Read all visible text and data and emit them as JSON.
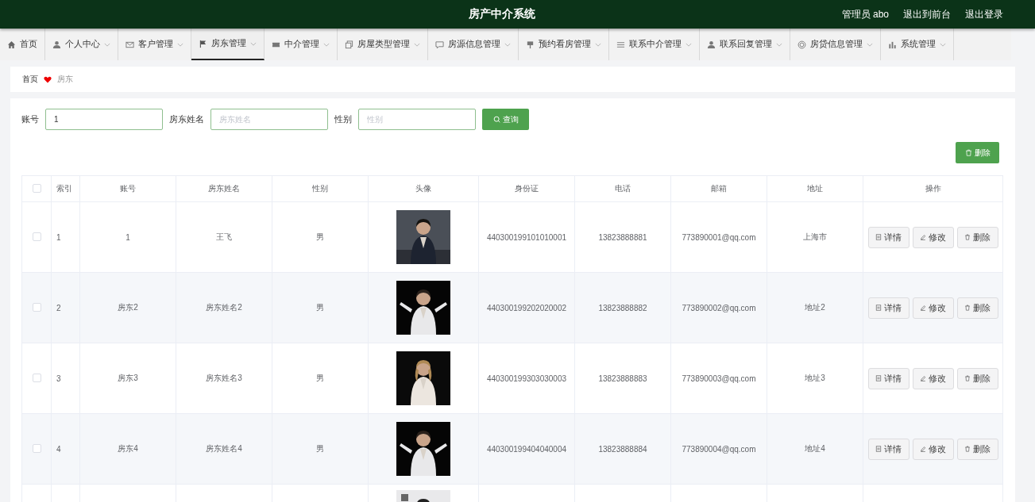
{
  "header": {
    "title": "房产中介系统",
    "links": [
      "管理员 abo",
      "退出到前台",
      "退出登录"
    ]
  },
  "nav": [
    {
      "label": "首页",
      "dropdown": false,
      "selected": false
    },
    {
      "label": "个人中心",
      "dropdown": true,
      "selected": false
    },
    {
      "label": "客户管理",
      "dropdown": true,
      "selected": false
    },
    {
      "label": "房东管理",
      "dropdown": true,
      "selected": true
    },
    {
      "label": "中介管理",
      "dropdown": true,
      "selected": false
    },
    {
      "label": "房屋类型管理",
      "dropdown": true,
      "selected": false
    },
    {
      "label": "房源信息管理",
      "dropdown": true,
      "selected": false
    },
    {
      "label": "预约看房管理",
      "dropdown": true,
      "selected": false
    },
    {
      "label": "联系中介管理",
      "dropdown": true,
      "selected": false
    },
    {
      "label": "联系回复管理",
      "dropdown": true,
      "selected": false
    },
    {
      "label": "房贷信息管理",
      "dropdown": true,
      "selected": false
    },
    {
      "label": "系统管理",
      "dropdown": true,
      "selected": false
    }
  ],
  "breadcrumb": [
    "首页",
    "房东"
  ],
  "search": {
    "fields": [
      {
        "label": "账号",
        "value": "1"
      },
      {
        "label": "房东姓名",
        "placeholder": "房东姓名"
      },
      {
        "label": "性别",
        "placeholder": "性别"
      }
    ],
    "button": "查询"
  },
  "delete_button": "删除",
  "table": {
    "columns": [
      "索引",
      "账号",
      "房东姓名",
      "性别",
      "头像",
      "身份证",
      "电话",
      "邮箱",
      "地址",
      "操作"
    ],
    "header_checked": false,
    "rows": [
      {
        "checked": false,
        "index": "1",
        "account": "1",
        "name": "王飞",
        "gender": "男",
        "id_card": "440300199101010001",
        "phone": "13823888881",
        "email": "773890001@qq.com",
        "address": "上海市",
        "actions": [
          "详情",
          "修改",
          "删除"
        ]
      },
      {
        "checked": false,
        "index": "2",
        "account": "房东2",
        "name": "房东姓名2",
        "gender": "男",
        "id_card": "440300199202020002",
        "phone": "13823888882",
        "email": "773890002@qq.com",
        "address": "地址2",
        "actions": [
          "详情",
          "修改",
          "删除"
        ]
      },
      {
        "checked": false,
        "index": "3",
        "account": "房东3",
        "name": "房东姓名3",
        "gender": "男",
        "id_card": "440300199303030003",
        "phone": "13823888883",
        "email": "773890003@qq.com",
        "address": "地址3",
        "actions": [
          "详情",
          "修改",
          "删除"
        ]
      },
      {
        "checked": false,
        "index": "4",
        "account": "房东4",
        "name": "房东姓名4",
        "gender": "男",
        "id_card": "440300199404040004",
        "phone": "13823888884",
        "email": "773890004@qq.com",
        "address": "地址4",
        "actions": [
          "详情",
          "修改",
          "删除"
        ]
      }
    ]
  }
}
